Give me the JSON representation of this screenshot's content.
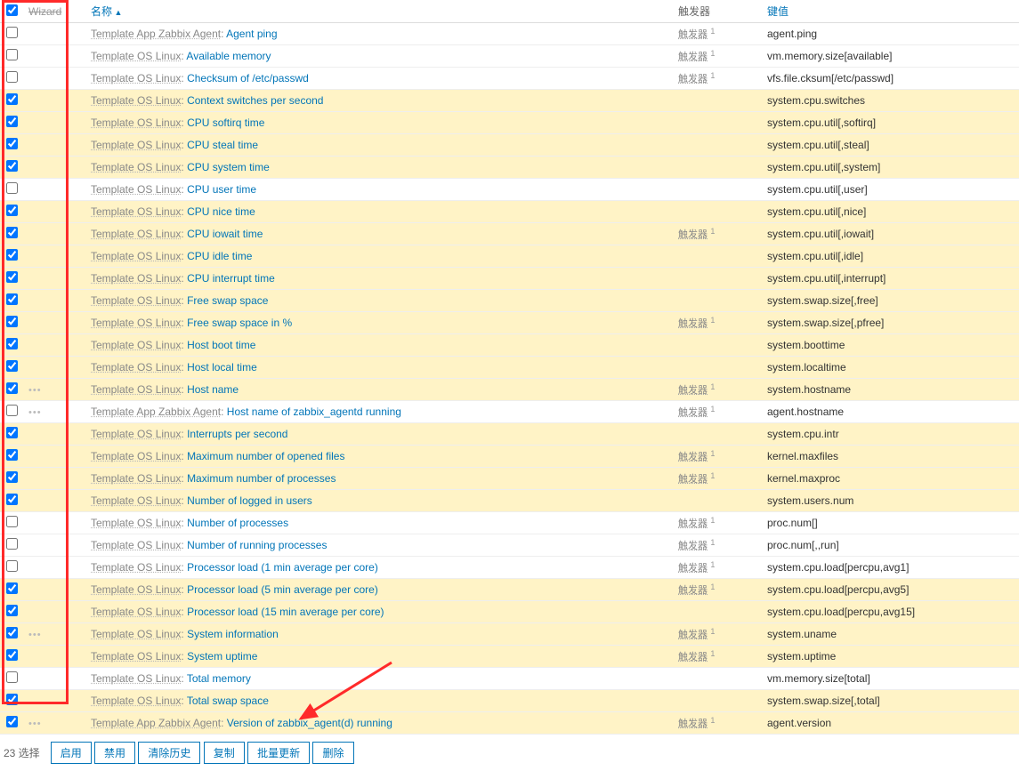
{
  "headers": {
    "wizard": "Wizard",
    "name": "名称",
    "triggers": "触发器",
    "key": "键值"
  },
  "footer": {
    "count_label": "23 选择",
    "buttons": [
      "启用",
      "禁用",
      "清除历史",
      "复制",
      "批量更新",
      "删除"
    ]
  },
  "rows": [
    {
      "sel": false,
      "dots": false,
      "tpl": "Template App Zabbix Agent",
      "item": "Agent ping",
      "trig": "触发器",
      "trign": "1",
      "key": "agent.ping"
    },
    {
      "sel": false,
      "dots": false,
      "tpl": "Template OS Linux",
      "item": "Available memory",
      "trig": "触发器",
      "trign": "1",
      "key": "vm.memory.size[available]"
    },
    {
      "sel": false,
      "dots": false,
      "tpl": "Template OS Linux",
      "item": "Checksum of /etc/passwd",
      "trig": "触发器",
      "trign": "1",
      "key": "vfs.file.cksum[/etc/passwd]"
    },
    {
      "sel": true,
      "dots": false,
      "tpl": "Template OS Linux",
      "item": "Context switches per second",
      "trig": "",
      "trign": "",
      "key": "system.cpu.switches"
    },
    {
      "sel": true,
      "dots": false,
      "tpl": "Template OS Linux",
      "item": "CPU softirq time",
      "trig": "",
      "trign": "",
      "key": "system.cpu.util[,softirq]"
    },
    {
      "sel": true,
      "dots": false,
      "tpl": "Template OS Linux",
      "item": "CPU steal time",
      "trig": "",
      "trign": "",
      "key": "system.cpu.util[,steal]"
    },
    {
      "sel": true,
      "dots": false,
      "tpl": "Template OS Linux",
      "item": "CPU system time",
      "trig": "",
      "trign": "",
      "key": "system.cpu.util[,system]"
    },
    {
      "sel": false,
      "dots": false,
      "tpl": "Template OS Linux",
      "item": "CPU user time",
      "trig": "",
      "trign": "",
      "key": "system.cpu.util[,user]"
    },
    {
      "sel": true,
      "dots": false,
      "tpl": "Template OS Linux",
      "item": "CPU nice time",
      "trig": "",
      "trign": "",
      "key": "system.cpu.util[,nice]"
    },
    {
      "sel": true,
      "dots": false,
      "tpl": "Template OS Linux",
      "item": "CPU iowait time",
      "trig": "触发器",
      "trign": "1",
      "key": "system.cpu.util[,iowait]"
    },
    {
      "sel": true,
      "dots": false,
      "tpl": "Template OS Linux",
      "item": "CPU idle time",
      "trig": "",
      "trign": "",
      "key": "system.cpu.util[,idle]"
    },
    {
      "sel": true,
      "dots": false,
      "tpl": "Template OS Linux",
      "item": "CPU interrupt time",
      "trig": "",
      "trign": "",
      "key": "system.cpu.util[,interrupt]"
    },
    {
      "sel": true,
      "dots": false,
      "tpl": "Template OS Linux",
      "item": "Free swap space",
      "trig": "",
      "trign": "",
      "key": "system.swap.size[,free]"
    },
    {
      "sel": true,
      "dots": false,
      "tpl": "Template OS Linux",
      "item": "Free swap space in %",
      "trig": "触发器",
      "trign": "1",
      "key": "system.swap.size[,pfree]"
    },
    {
      "sel": true,
      "dots": false,
      "tpl": "Template OS Linux",
      "item": "Host boot time",
      "trig": "",
      "trign": "",
      "key": "system.boottime"
    },
    {
      "sel": true,
      "dots": false,
      "tpl": "Template OS Linux",
      "item": "Host local time",
      "trig": "",
      "trign": "",
      "key": "system.localtime"
    },
    {
      "sel": true,
      "dots": true,
      "tpl": "Template OS Linux",
      "item": "Host name",
      "trig": "触发器",
      "trign": "1",
      "key": "system.hostname"
    },
    {
      "sel": false,
      "dots": true,
      "tpl": "Template App Zabbix Agent",
      "item": "Host name of zabbix_agentd running",
      "trig": "触发器",
      "trign": "1",
      "key": "agent.hostname"
    },
    {
      "sel": true,
      "dots": false,
      "tpl": "Template OS Linux",
      "item": "Interrupts per second",
      "trig": "",
      "trign": "",
      "key": "system.cpu.intr"
    },
    {
      "sel": true,
      "dots": false,
      "tpl": "Template OS Linux",
      "item": "Maximum number of opened files",
      "trig": "触发器",
      "trign": "1",
      "key": "kernel.maxfiles"
    },
    {
      "sel": true,
      "dots": false,
      "tpl": "Template OS Linux",
      "item": "Maximum number of processes",
      "trig": "触发器",
      "trign": "1",
      "key": "kernel.maxproc"
    },
    {
      "sel": true,
      "dots": false,
      "tpl": "Template OS Linux",
      "item": "Number of logged in users",
      "trig": "",
      "trign": "",
      "key": "system.users.num"
    },
    {
      "sel": false,
      "dots": false,
      "tpl": "Template OS Linux",
      "item": "Number of processes",
      "trig": "触发器",
      "trign": "1",
      "key": "proc.num[]"
    },
    {
      "sel": false,
      "dots": false,
      "tpl": "Template OS Linux",
      "item": "Number of running processes",
      "trig": "触发器",
      "trign": "1",
      "key": "proc.num[,,run]"
    },
    {
      "sel": false,
      "dots": false,
      "tpl": "Template OS Linux",
      "item": "Processor load (1 min average per core)",
      "trig": "触发器",
      "trign": "1",
      "key": "system.cpu.load[percpu,avg1]"
    },
    {
      "sel": true,
      "dots": false,
      "tpl": "Template OS Linux",
      "item": "Processor load (5 min average per core)",
      "trig": "触发器",
      "trign": "1",
      "key": "system.cpu.load[percpu,avg5]"
    },
    {
      "sel": true,
      "dots": false,
      "tpl": "Template OS Linux",
      "item": "Processor load (15 min average per core)",
      "trig": "",
      "trign": "",
      "key": "system.cpu.load[percpu,avg15]"
    },
    {
      "sel": true,
      "dots": true,
      "tpl": "Template OS Linux",
      "item": "System information",
      "trig": "触发器",
      "trign": "1",
      "key": "system.uname"
    },
    {
      "sel": true,
      "dots": false,
      "tpl": "Template OS Linux",
      "item": "System uptime",
      "trig": "触发器",
      "trign": "1",
      "key": "system.uptime"
    },
    {
      "sel": false,
      "dots": false,
      "tpl": "Template OS Linux",
      "item": "Total memory",
      "trig": "",
      "trign": "",
      "key": "vm.memory.size[total]"
    },
    {
      "sel": true,
      "dots": false,
      "tpl": "Template OS Linux",
      "item": "Total swap space",
      "trig": "",
      "trign": "",
      "key": "system.swap.size[,total]"
    },
    {
      "sel": true,
      "dots": true,
      "tpl": "Template App Zabbix Agent",
      "item": "Version of zabbix_agent(d) running",
      "trig": "触发器",
      "trign": "1",
      "key": "agent.version"
    }
  ]
}
